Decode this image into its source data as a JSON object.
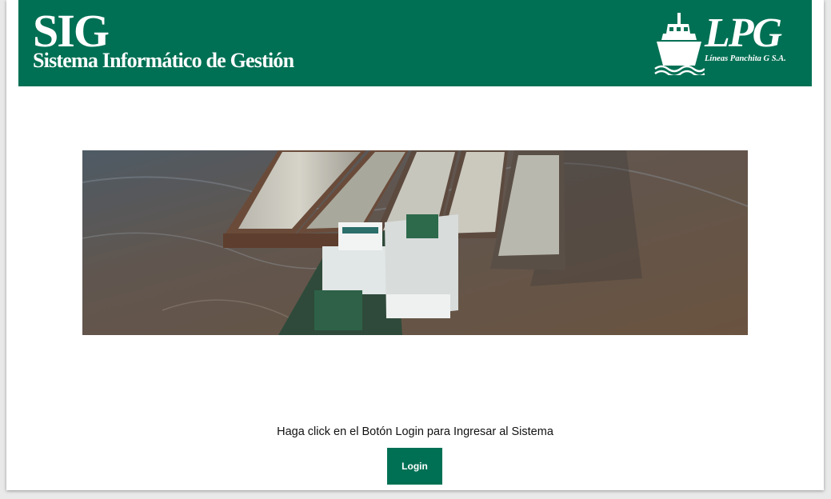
{
  "header": {
    "app_title": "SIG",
    "app_subtitle": "Sistema Informático de Gestión",
    "logo_text": "LPG",
    "logo_subtext": "Líneas Panchita G S.A."
  },
  "main": {
    "hero_image": "barge-convoy-photo",
    "instruction": "Haga click en el Botón Login para Ingresar al Sistema",
    "login_label": "Login"
  },
  "colors": {
    "brand": "#007054",
    "background": "#ffffff",
    "river": "#6c5647"
  }
}
